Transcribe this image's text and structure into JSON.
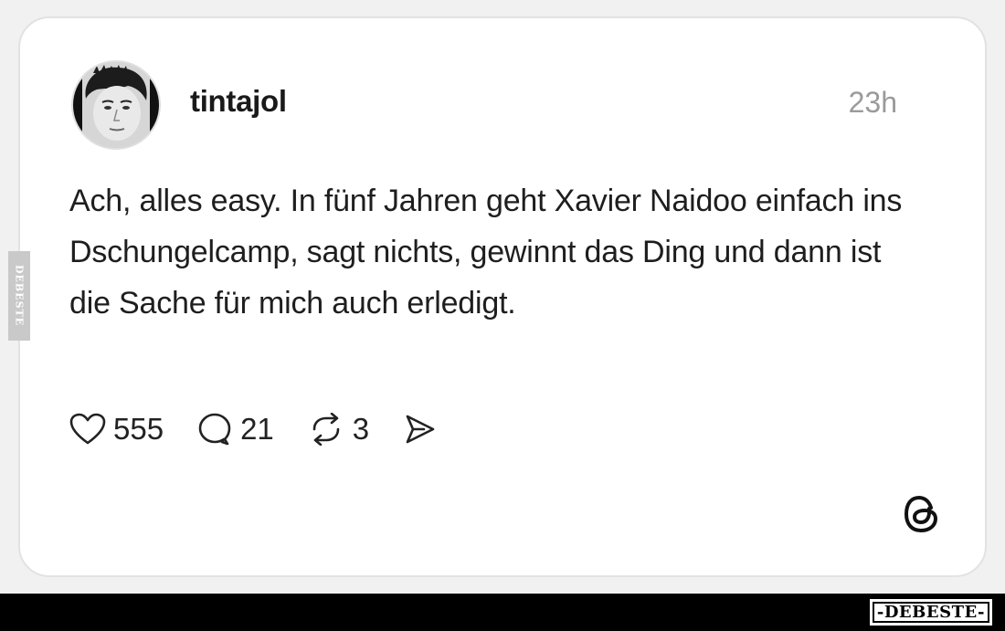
{
  "post": {
    "username": "tintajol",
    "timestamp": "23h",
    "text": "Ach, alles easy. In fünf Jahren geht Xavier Naidoo einfach ins Dschungelcamp, sagt nichts, gewinnt das Ding und dann ist die Sache für mich auch erledigt.",
    "actions": {
      "likes": "555",
      "comments": "21",
      "reposts": "3"
    }
  },
  "icons": {
    "like": "heart-icon",
    "comment": "speech-bubble-icon",
    "repost": "repost-icon",
    "share": "send-icon",
    "brand": "threads-logo-icon"
  },
  "watermark": {
    "side": "DEBESTE",
    "bottom": "-DEBESTE-"
  },
  "colors": {
    "background": "#f1f1f1",
    "card": "#ffffff",
    "text": "#1e1e1e",
    "muted": "#9a9a9a",
    "footer": "#000000"
  }
}
